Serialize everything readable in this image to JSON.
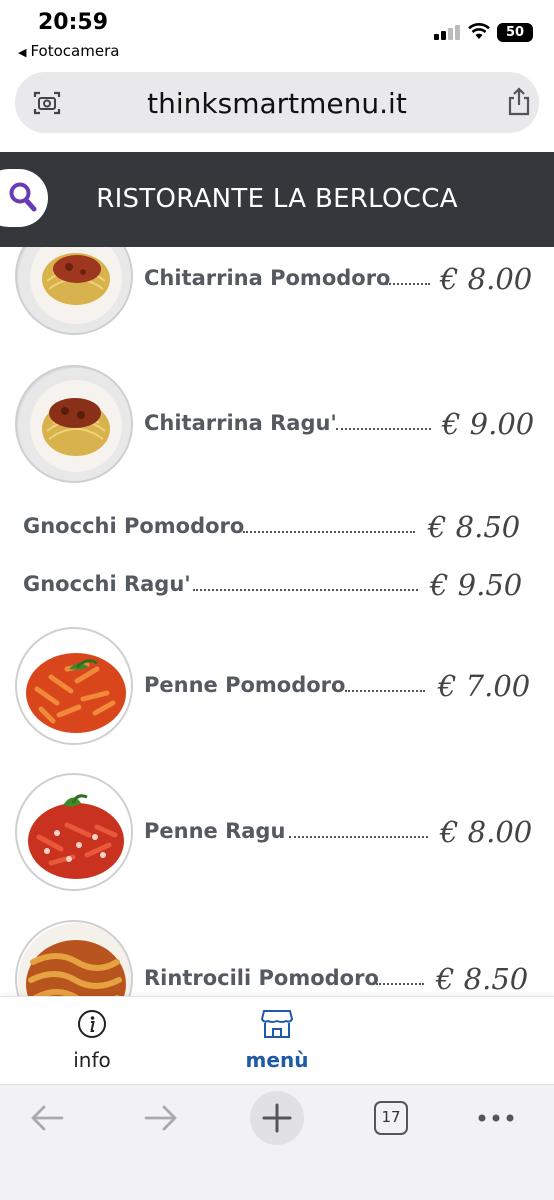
{
  "status_bar": {
    "time": "20:59",
    "back_app": "Fotocamera",
    "battery": "50"
  },
  "address_bar": {
    "url": "thinksmartmenu.it"
  },
  "header": {
    "title": "RISTORANTE LA BERLOCCA"
  },
  "menu_items": [
    {
      "name": "Chitarrina Pomodoro",
      "price": "€ 8.00",
      "has_image": true
    },
    {
      "name": "Chitarrina Ragu'",
      "price": "€ 9.00",
      "has_image": true
    },
    {
      "name": "Gnocchi Pomodoro",
      "price": "€ 8.50",
      "has_image": false
    },
    {
      "name": "Gnocchi Ragu'",
      "price": "€ 9.50",
      "has_image": false
    },
    {
      "name": "Penne Pomodoro",
      "price": "€ 7.00",
      "has_image": true
    },
    {
      "name": "Penne Ragu",
      "price": "€ 8.00",
      "has_image": true
    },
    {
      "name": "Rintrocili Pomodoro",
      "price": "€ 8.50",
      "has_image": true
    }
  ],
  "tab_bar": {
    "info_label": "info",
    "menu_label": "menù",
    "active_color": "#1e5aa8"
  },
  "browser_toolbar": {
    "tab_count": "17"
  },
  "colors": {
    "header_bg": "#34383d",
    "search_icon": "#6a3bb5"
  }
}
